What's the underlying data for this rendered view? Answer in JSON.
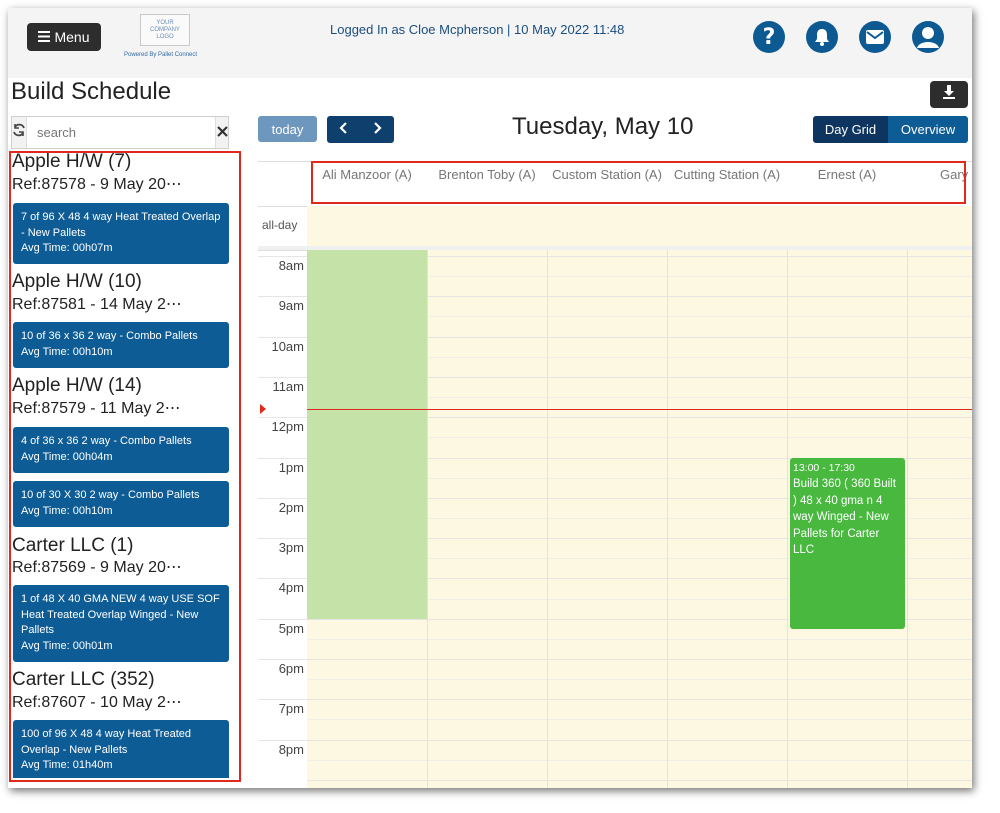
{
  "header": {
    "menu_label": "Menu",
    "logo_lines": [
      "YOUR",
      "COMPANY",
      "LOGO"
    ],
    "powered_by": "Powered By Pallet Connect",
    "logged_in": "Logged In as Cloe Mcpherson | 10 May 2022 11:48",
    "icons": [
      "help-icon",
      "bell-icon",
      "mail-icon",
      "user-icon"
    ],
    "accent_color": "#0d5a92"
  },
  "page": {
    "title": "Build Schedule"
  },
  "search": {
    "placeholder": "search"
  },
  "jobs": [
    {
      "title": "Apple H/W (7)",
      "ref": "Ref:87578   -   9 May 20⋯",
      "cards": [
        {
          "desc": "7 of 96 X 48 4 way Heat Treated Overlap - New Pallets",
          "avg": "Avg Time: 00h07m"
        }
      ]
    },
    {
      "title": "Apple H/W (10)",
      "ref": "Ref:87581   -   14 May 2⋯",
      "cards": [
        {
          "desc": "10 of 36 x 36 2 way - Combo Pallets",
          "avg": "Avg Time: 00h10m"
        }
      ]
    },
    {
      "title": "Apple H/W (14)",
      "ref": "Ref:87579   -   11 May 2⋯",
      "cards": [
        {
          "desc": "4 of 36 x 36 2 way - Combo Pallets",
          "avg": "Avg Time: 00h04m"
        },
        {
          "desc": "10 of 30 X 30 2 way - Combo Pallets",
          "avg": "Avg Time: 00h10m"
        }
      ]
    },
    {
      "title": "Carter LLC (1)",
      "ref": "Ref:87569   -   9 May 20⋯",
      "cards": [
        {
          "desc": "1 of 48 X 40 GMA NEW 4 way USE SOF Heat Treated Overlap Winged - New Pallets",
          "avg": "Avg Time: 00h01m"
        }
      ]
    },
    {
      "title": "Carter LLC (352)",
      "ref": "Ref:87607   -   10 May 2⋯",
      "cards": [
        {
          "desc": "100 of 96 X 48 4 way Heat Treated Overlap - New Pallets",
          "avg": "Avg Time: 01h40m"
        }
      ]
    }
  ],
  "calendar": {
    "today_label": "today",
    "prev_icon": "chevron-left-icon",
    "next_icon": "chevron-right-icon",
    "date_title": "Tuesday, May 10",
    "views": [
      {
        "label": "Day Grid",
        "active": true
      },
      {
        "label": "Overview",
        "active": false
      }
    ],
    "resources": [
      "Ali Manzoor (A)",
      "Brenton Toby (A)",
      "Custom Station (A)",
      "Cutting Station (A)",
      "Ernest (A)",
      "Gary"
    ],
    "allday_label": "all-day",
    "hours": [
      "8am",
      "9am",
      "10am",
      "11am",
      "12pm",
      "1pm",
      "2pm",
      "3pm",
      "4pm",
      "5pm",
      "6pm",
      "7pm",
      "8pm"
    ],
    "first_hour": 7.85,
    "now_hour": 11.8,
    "background_block": {
      "resource": 0,
      "start": 7.85,
      "end": 17.0,
      "color": "#c5e2a8"
    },
    "events": [
      {
        "resource": 4,
        "time": "13:00 - 17:30",
        "title": "Build 360 ( 360 Built ) 48 x 40 gma n 4 way Winged - New Pallets for Carter LLC",
        "start": 13.0,
        "end": 17.25,
        "color": "#48b83f"
      }
    ],
    "now_line_color": "#e0281d",
    "grid_bg": "#fdf8e2"
  }
}
